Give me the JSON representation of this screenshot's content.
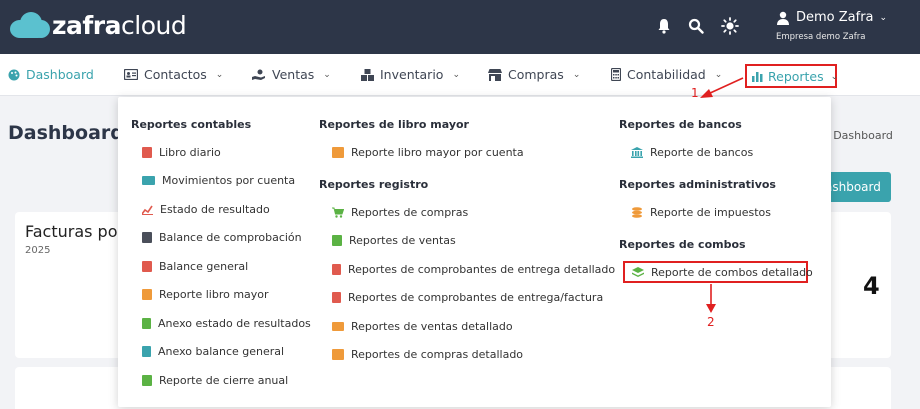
{
  "header": {
    "logo_bold": "zafra",
    "logo_light": "cloud",
    "icons": [
      "bell-icon",
      "search-icon",
      "sun-icon"
    ],
    "user_name": "Demo Zafra",
    "company": "Empresa demo Zafra"
  },
  "nav": {
    "items": [
      {
        "label": "Dashboard",
        "icon": "palette-icon"
      },
      {
        "label": "Contactos",
        "icon": "address-card-icon"
      },
      {
        "label": "Ventas",
        "icon": "hand-holding-icon"
      },
      {
        "label": "Inventario",
        "icon": "boxes-icon"
      },
      {
        "label": "Compras",
        "icon": "store-icon"
      },
      {
        "label": "Contabilidad",
        "icon": "calculator-icon"
      },
      {
        "label": "Reportes",
        "icon": "bar-chart-icon"
      }
    ]
  },
  "page": {
    "title": "Dashboard",
    "breadcrumb": "/ Dashboard",
    "button_label": "ashboard",
    "card_title": "Facturas po",
    "card_year": "2025",
    "card_number": "4"
  },
  "dropdown": {
    "col1": {
      "title": "Reportes contables",
      "items": [
        "Libro diario",
        "Movimientos por cuenta",
        "Estado de resultado",
        "Balance de comprobación",
        "Balance general",
        "Reporte libro mayor",
        "Anexo estado de resultados",
        "Anexo balance general",
        "Reporte de cierre anual"
      ]
    },
    "col2": {
      "title1": "Reportes de libro mayor",
      "items1": [
        "Reporte libro mayor por cuenta"
      ],
      "title2": "Reportes registro",
      "items2": [
        "Reportes de compras",
        "Reportes de ventas",
        "Reportes de comprobantes de entrega detallado",
        "Reportes de comprobantes de entrega/factura",
        "Reportes de ventas detallado",
        "Reportes de compras detallado"
      ]
    },
    "col3": {
      "title1": "Reportes de bancos",
      "items1": [
        "Reporte de bancos"
      ],
      "title2": "Reportes administrativos",
      "items2": [
        "Reporte de impuestos"
      ],
      "title3": "Reportes de combos",
      "items3": [
        "Reporte de combos detallado"
      ]
    }
  },
  "annotations": {
    "step1": "1",
    "step2": "2"
  },
  "colors": {
    "topbar": "#2d3648",
    "accent": "#3aa3ad",
    "highlight": "#e02020"
  }
}
